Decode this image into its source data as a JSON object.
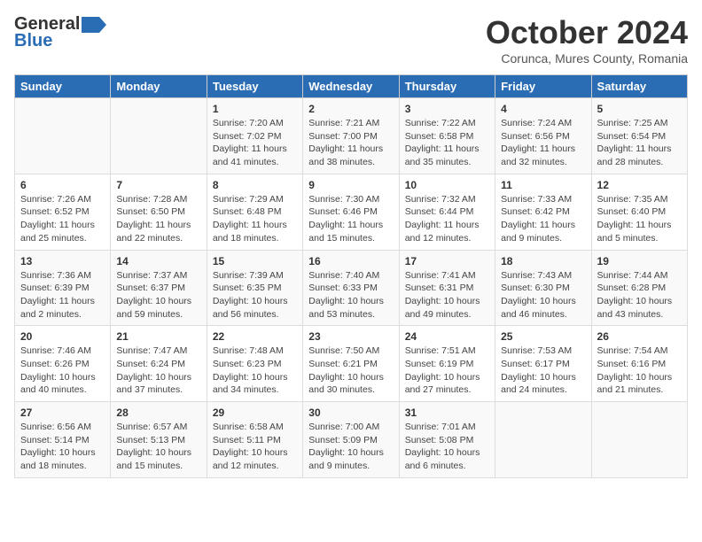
{
  "header": {
    "logo_general": "General",
    "logo_blue": "Blue",
    "month_title": "October 2024",
    "location": "Corunca, Mures County, Romania"
  },
  "days_of_week": [
    "Sunday",
    "Monday",
    "Tuesday",
    "Wednesday",
    "Thursday",
    "Friday",
    "Saturday"
  ],
  "weeks": [
    [
      {
        "day": "",
        "detail": ""
      },
      {
        "day": "",
        "detail": ""
      },
      {
        "day": "1",
        "detail": "Sunrise: 7:20 AM\nSunset: 7:02 PM\nDaylight: 11 hours and 41 minutes."
      },
      {
        "day": "2",
        "detail": "Sunrise: 7:21 AM\nSunset: 7:00 PM\nDaylight: 11 hours and 38 minutes."
      },
      {
        "day": "3",
        "detail": "Sunrise: 7:22 AM\nSunset: 6:58 PM\nDaylight: 11 hours and 35 minutes."
      },
      {
        "day": "4",
        "detail": "Sunrise: 7:24 AM\nSunset: 6:56 PM\nDaylight: 11 hours and 32 minutes."
      },
      {
        "day": "5",
        "detail": "Sunrise: 7:25 AM\nSunset: 6:54 PM\nDaylight: 11 hours and 28 minutes."
      }
    ],
    [
      {
        "day": "6",
        "detail": "Sunrise: 7:26 AM\nSunset: 6:52 PM\nDaylight: 11 hours and 25 minutes."
      },
      {
        "day": "7",
        "detail": "Sunrise: 7:28 AM\nSunset: 6:50 PM\nDaylight: 11 hours and 22 minutes."
      },
      {
        "day": "8",
        "detail": "Sunrise: 7:29 AM\nSunset: 6:48 PM\nDaylight: 11 hours and 18 minutes."
      },
      {
        "day": "9",
        "detail": "Sunrise: 7:30 AM\nSunset: 6:46 PM\nDaylight: 11 hours and 15 minutes."
      },
      {
        "day": "10",
        "detail": "Sunrise: 7:32 AM\nSunset: 6:44 PM\nDaylight: 11 hours and 12 minutes."
      },
      {
        "day": "11",
        "detail": "Sunrise: 7:33 AM\nSunset: 6:42 PM\nDaylight: 11 hours and 9 minutes."
      },
      {
        "day": "12",
        "detail": "Sunrise: 7:35 AM\nSunset: 6:40 PM\nDaylight: 11 hours and 5 minutes."
      }
    ],
    [
      {
        "day": "13",
        "detail": "Sunrise: 7:36 AM\nSunset: 6:39 PM\nDaylight: 11 hours and 2 minutes."
      },
      {
        "day": "14",
        "detail": "Sunrise: 7:37 AM\nSunset: 6:37 PM\nDaylight: 10 hours and 59 minutes."
      },
      {
        "day": "15",
        "detail": "Sunrise: 7:39 AM\nSunset: 6:35 PM\nDaylight: 10 hours and 56 minutes."
      },
      {
        "day": "16",
        "detail": "Sunrise: 7:40 AM\nSunset: 6:33 PM\nDaylight: 10 hours and 53 minutes."
      },
      {
        "day": "17",
        "detail": "Sunrise: 7:41 AM\nSunset: 6:31 PM\nDaylight: 10 hours and 49 minutes."
      },
      {
        "day": "18",
        "detail": "Sunrise: 7:43 AM\nSunset: 6:30 PM\nDaylight: 10 hours and 46 minutes."
      },
      {
        "day": "19",
        "detail": "Sunrise: 7:44 AM\nSunset: 6:28 PM\nDaylight: 10 hours and 43 minutes."
      }
    ],
    [
      {
        "day": "20",
        "detail": "Sunrise: 7:46 AM\nSunset: 6:26 PM\nDaylight: 10 hours and 40 minutes."
      },
      {
        "day": "21",
        "detail": "Sunrise: 7:47 AM\nSunset: 6:24 PM\nDaylight: 10 hours and 37 minutes."
      },
      {
        "day": "22",
        "detail": "Sunrise: 7:48 AM\nSunset: 6:23 PM\nDaylight: 10 hours and 34 minutes."
      },
      {
        "day": "23",
        "detail": "Sunrise: 7:50 AM\nSunset: 6:21 PM\nDaylight: 10 hours and 30 minutes."
      },
      {
        "day": "24",
        "detail": "Sunrise: 7:51 AM\nSunset: 6:19 PM\nDaylight: 10 hours and 27 minutes."
      },
      {
        "day": "25",
        "detail": "Sunrise: 7:53 AM\nSunset: 6:17 PM\nDaylight: 10 hours and 24 minutes."
      },
      {
        "day": "26",
        "detail": "Sunrise: 7:54 AM\nSunset: 6:16 PM\nDaylight: 10 hours and 21 minutes."
      }
    ],
    [
      {
        "day": "27",
        "detail": "Sunrise: 6:56 AM\nSunset: 5:14 PM\nDaylight: 10 hours and 18 minutes."
      },
      {
        "day": "28",
        "detail": "Sunrise: 6:57 AM\nSunset: 5:13 PM\nDaylight: 10 hours and 15 minutes."
      },
      {
        "day": "29",
        "detail": "Sunrise: 6:58 AM\nSunset: 5:11 PM\nDaylight: 10 hours and 12 minutes."
      },
      {
        "day": "30",
        "detail": "Sunrise: 7:00 AM\nSunset: 5:09 PM\nDaylight: 10 hours and 9 minutes."
      },
      {
        "day": "31",
        "detail": "Sunrise: 7:01 AM\nSunset: 5:08 PM\nDaylight: 10 hours and 6 minutes."
      },
      {
        "day": "",
        "detail": ""
      },
      {
        "day": "",
        "detail": ""
      }
    ]
  ]
}
